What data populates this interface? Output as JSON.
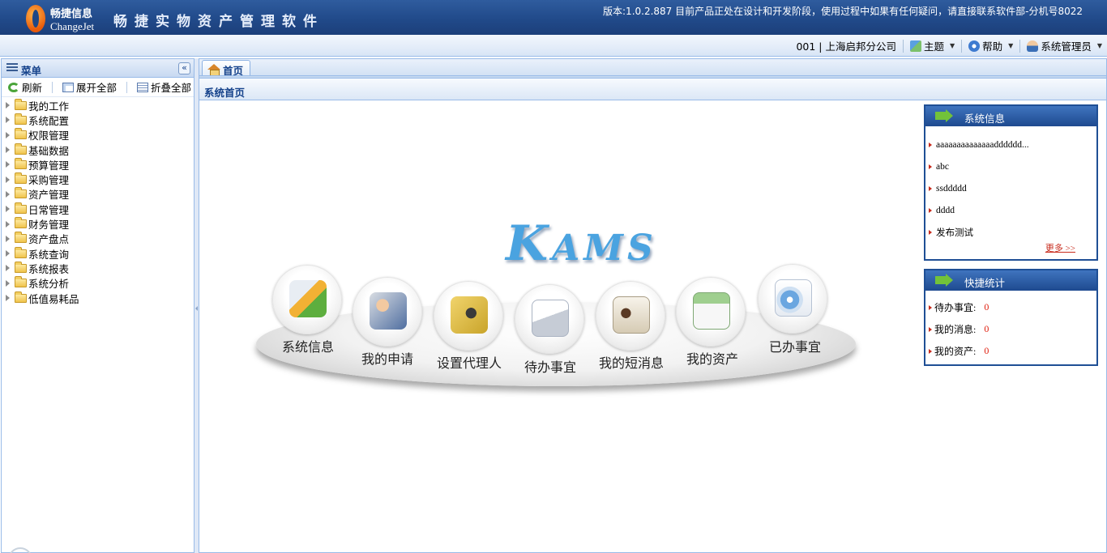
{
  "banner": {
    "logo_cn": "畅捷信息",
    "logo_en": "ChangeJet",
    "app_title": "畅捷实物资产管理软件",
    "version_notice": "版本:1.0.2.887 目前产品正处在设计和开发阶段，使用过程中如果有任何疑问，请直接联系软件部-分机号8022"
  },
  "topbar": {
    "org": "001 | 上海启邦分公司",
    "theme": "主题",
    "help": "帮助",
    "user": "系统管理员"
  },
  "menu": {
    "title": "菜单",
    "collapse_icon": "«",
    "refresh": "刷新",
    "expand_all": "展开全部",
    "collapse_all": "折叠全部",
    "items": [
      "我的工作",
      "系统配置",
      "权限管理",
      "基础数据",
      "预算管理",
      "采购管理",
      "资产管理",
      "日常管理",
      "财务管理",
      "资产盘点",
      "系统查询",
      "系统报表",
      "系统分析",
      "低值易耗品"
    ]
  },
  "tabs": {
    "home": "首页"
  },
  "page": {
    "title": "系统首页"
  },
  "center": {
    "logo": "KAMS",
    "logo_parts": [
      "K",
      "A",
      "M",
      "S"
    ],
    "quick_links": [
      "系统信息",
      "我的申请",
      "设置代理人",
      "待办事宜",
      "我的短消息",
      "我的资产",
      "已办事宜"
    ]
  },
  "sys_info": {
    "title": "系统信息",
    "items": [
      "aaaaaaaaaaaaaadddddd...",
      "abc",
      "ssddddd",
      "dddd",
      "发布测试"
    ],
    "more": "更多 >>"
  },
  "quick_stats": {
    "title": "快捷统计",
    "rows": [
      {
        "label": "待办事宜:",
        "value": "0"
      },
      {
        "label": "我的消息:",
        "value": "0"
      },
      {
        "label": "我的资产:",
        "value": "0"
      }
    ]
  }
}
